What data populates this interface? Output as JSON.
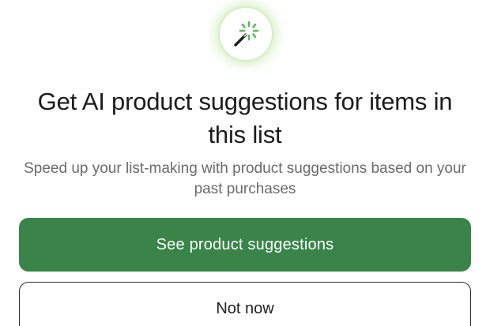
{
  "dialog": {
    "icon": "magic-wand-sparkle-icon",
    "title": "Get AI product suggestions for items in this list",
    "subtitle": "Speed up your list-making with product suggestions based on your past purchases",
    "primary_button": "See product suggestions",
    "secondary_button": "Not now"
  },
  "colors": {
    "primary": "#3a8449",
    "icon_glow": "#b7e296",
    "sparkle": "#5fb85a"
  }
}
